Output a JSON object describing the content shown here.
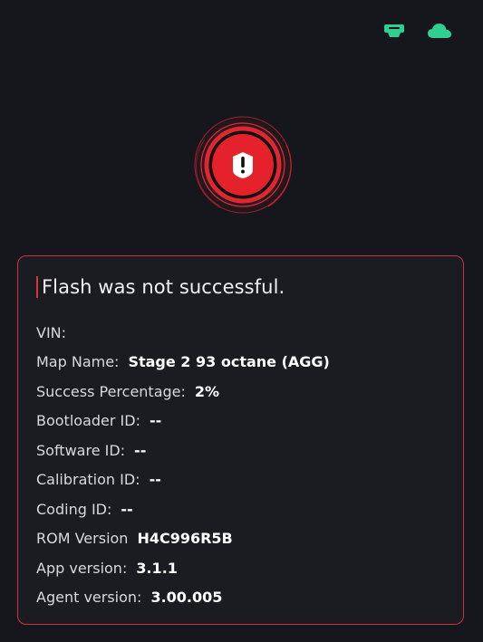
{
  "status_bar": {
    "icons": [
      "usb-adapter-icon",
      "cloud-icon"
    ],
    "icon_color": "#2ecf8f"
  },
  "alert": {
    "icon": "exclamation-icon",
    "ring_color": "#e0262f"
  },
  "result": {
    "title": "Flash was not successful.",
    "accent_color": "#d0303a",
    "details": [
      {
        "label": "VIN:",
        "value": ""
      },
      {
        "label": "Map Name:",
        "value": "Stage 2 93 octane (AGG)"
      },
      {
        "label": "Success Percentage:",
        "value": "2%"
      },
      {
        "label": "Bootloader ID:",
        "value": "--"
      },
      {
        "label": "Software ID:",
        "value": "--"
      },
      {
        "label": "Calibration ID:",
        "value": "--"
      },
      {
        "label": "Coding ID:",
        "value": "--"
      },
      {
        "label": "ROM Version",
        "value": "H4C996R5B"
      },
      {
        "label": "App version:",
        "value": "3.1.1"
      },
      {
        "label": "Agent version:",
        "value": "3.00.005"
      }
    ]
  }
}
